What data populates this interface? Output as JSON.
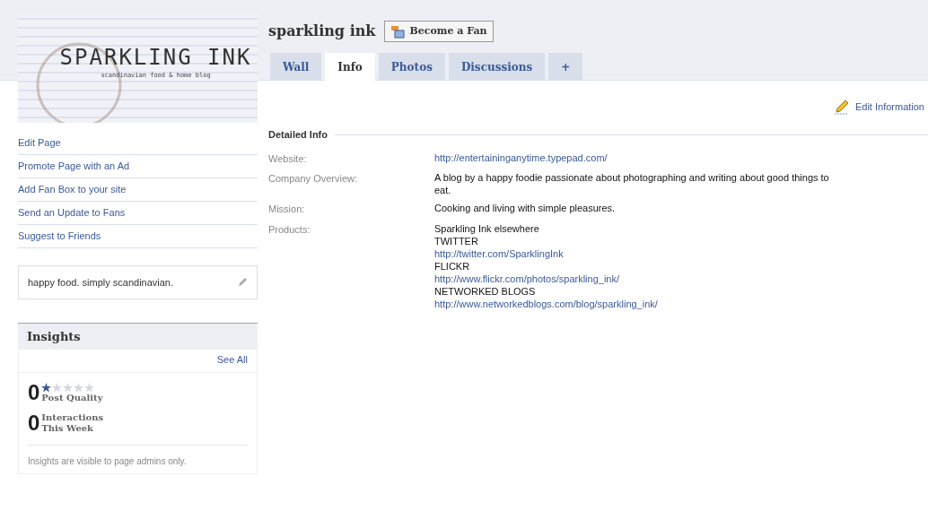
{
  "logo": {
    "title": "SPARKLING INK",
    "subtitle": "scandinavian food & home blog"
  },
  "sidebar": {
    "links": [
      "Edit Page",
      "Promote Page with an Ad",
      "Add Fan Box to your site",
      "Send an Update to Fans",
      "Suggest to Friends"
    ],
    "status": "happy food. simply scandinavian.",
    "insights": {
      "title": "Insights",
      "see_all": "See All",
      "metrics": [
        {
          "value": "0",
          "label": "Post Quality",
          "stars": 1
        },
        {
          "value": "0",
          "label": "Interactions This Week"
        }
      ],
      "note": "Insights are visible to page admins only."
    }
  },
  "page": {
    "title": "sparkling ink",
    "fan_button": "Become a Fan",
    "tabs": [
      {
        "label": "Wall",
        "selected": false
      },
      {
        "label": "Info",
        "selected": true
      },
      {
        "label": "Photos",
        "selected": false
      },
      {
        "label": "Discussions",
        "selected": false
      },
      {
        "label": "+",
        "selected": false
      }
    ],
    "edit_link": "Edit Information",
    "section": "Detailed Info",
    "fields": [
      {
        "label": "Website:",
        "lines": [
          {
            "kind": "link",
            "text": "http://entertaininganytime.typepad.com/"
          }
        ]
      },
      {
        "label": "Company Overview:",
        "lines": [
          {
            "kind": "text",
            "text": "A blog by a happy foodie passionate about photographing and writing about good things to eat."
          }
        ]
      },
      {
        "label": "Mission:",
        "lines": [
          {
            "kind": "text",
            "text": "Cooking and living with simple pleasures."
          }
        ]
      },
      {
        "label": "Products:",
        "lines": [
          {
            "kind": "text",
            "text": "Sparkling Ink elsewhere"
          },
          {
            "kind": "text",
            "text": "TWITTER"
          },
          {
            "kind": "link",
            "text": "http://twitter.com/SparklingInk"
          },
          {
            "kind": "text",
            "text": "FLICKR"
          },
          {
            "kind": "link",
            "text": "http://www.flickr.com/photos/sparkling_ink/"
          },
          {
            "kind": "text",
            "text": "NETWORKED BLOGS"
          },
          {
            "kind": "link",
            "text": "http://www.networkedblogs.com/blog/sparkling_ink/"
          }
        ]
      }
    ]
  }
}
